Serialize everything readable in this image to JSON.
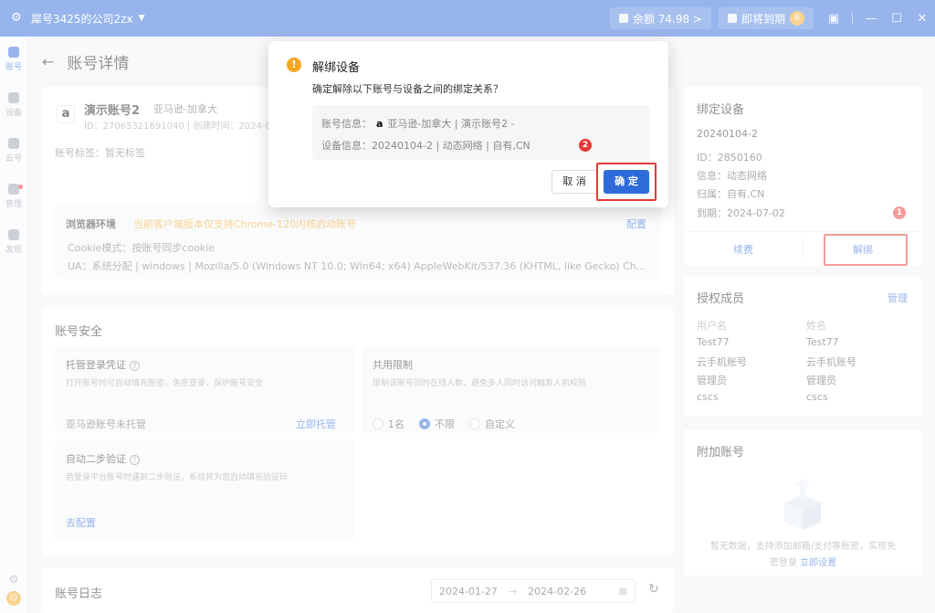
{
  "titlebar": {
    "company": "犀号3425的公司2zx",
    "balance": "余额 74.98 >",
    "expiring_label": "即将到期",
    "expiring_count": "6"
  },
  "rail": {
    "items": [
      {
        "label": "账号"
      },
      {
        "label": "设备"
      },
      {
        "label": "云号"
      },
      {
        "label": "管理"
      },
      {
        "label": "发现"
      }
    ]
  },
  "page": {
    "back": "←",
    "title": "账号详情"
  },
  "account": {
    "logo": "a",
    "name": "演示账号2",
    "platform": "亚马逊-加拿大",
    "meta": "ID：27065321691040 | 创建时间：2024-01",
    "tags": "账号标签：暂无标签"
  },
  "browser_env": {
    "title": "浏览器环境",
    "warning": "当前客户端版本仅支持Chrome-120内核启动账号",
    "config": "配置",
    "cookie": "Cookie模式：按账号同步cookie",
    "ua": "UA：系统分配 | windows | Mozilla/5.0 (Windows NT 10.0; Win64; x64) AppleWebKit/537.36 (KHTML, like Gecko) Ch..."
  },
  "security": {
    "title": "账号安全",
    "trust": {
      "title": "托管登录凭证",
      "desc": "打开账号时可自动填充账密，免密登录，保护账号安全",
      "status": "亚马逊账号未托管",
      "action": "立即托管"
    },
    "share": {
      "title": "共用限制",
      "desc": "限制该账号同时在线人数，避免多人同时访问触发人机校验",
      "options": [
        "1名",
        "不限",
        "自定义"
      ],
      "selected": "不限"
    },
    "twofa": {
      "title": "自动二步验证",
      "desc": "若登录平台账号时遇到二步验证，系统将为您自动填充验证码",
      "action": "去配置"
    }
  },
  "log": {
    "title": "账号日志",
    "date_from": "2024-01-27",
    "date_to": "2024-02-26",
    "arrow": "→"
  },
  "bind": {
    "title": "绑定设备",
    "device": "20240104-2",
    "id": "ID：2850160",
    "info": "信息：动态网络",
    "owner": "归属：自有,CN",
    "expire": "到期：2024-07-02",
    "renew": "续费",
    "unbind": "解绑",
    "step1": "1"
  },
  "auth": {
    "title": "授权成员",
    "manage": "管理",
    "headers": [
      "用户名",
      "姓名"
    ],
    "rows": [
      [
        "Test77",
        "Test77"
      ],
      [
        "云手机账号",
        "云手机账号"
      ],
      [
        "管理员",
        "管理员"
      ],
      [
        "cscs",
        "cscs"
      ]
    ]
  },
  "extra": {
    "title": "附加账号",
    "empty_line1": "暂无数据，支持添加邮箱/支付等账密，实现免",
    "empty_line2": "密登录",
    "empty_link": "立即设置"
  },
  "modal": {
    "warn_icon": "!",
    "title": "解绑设备",
    "message": "确定解除以下账号与设备之间的绑定关系？",
    "acc_label": "账号信息：",
    "acc_logo": "a",
    "acc_value": "亚马逊-加拿大 | 演示账号2 -",
    "dev_label": "设备信息：",
    "dev_value": "20240104-2 | 动态网络 | 自有,CN",
    "cancel": "取 消",
    "ok": "确 定",
    "step2": "2"
  },
  "colors": {
    "primary": "#2f6bd8",
    "warning": "#f5a623",
    "highlight": "#e53935"
  }
}
